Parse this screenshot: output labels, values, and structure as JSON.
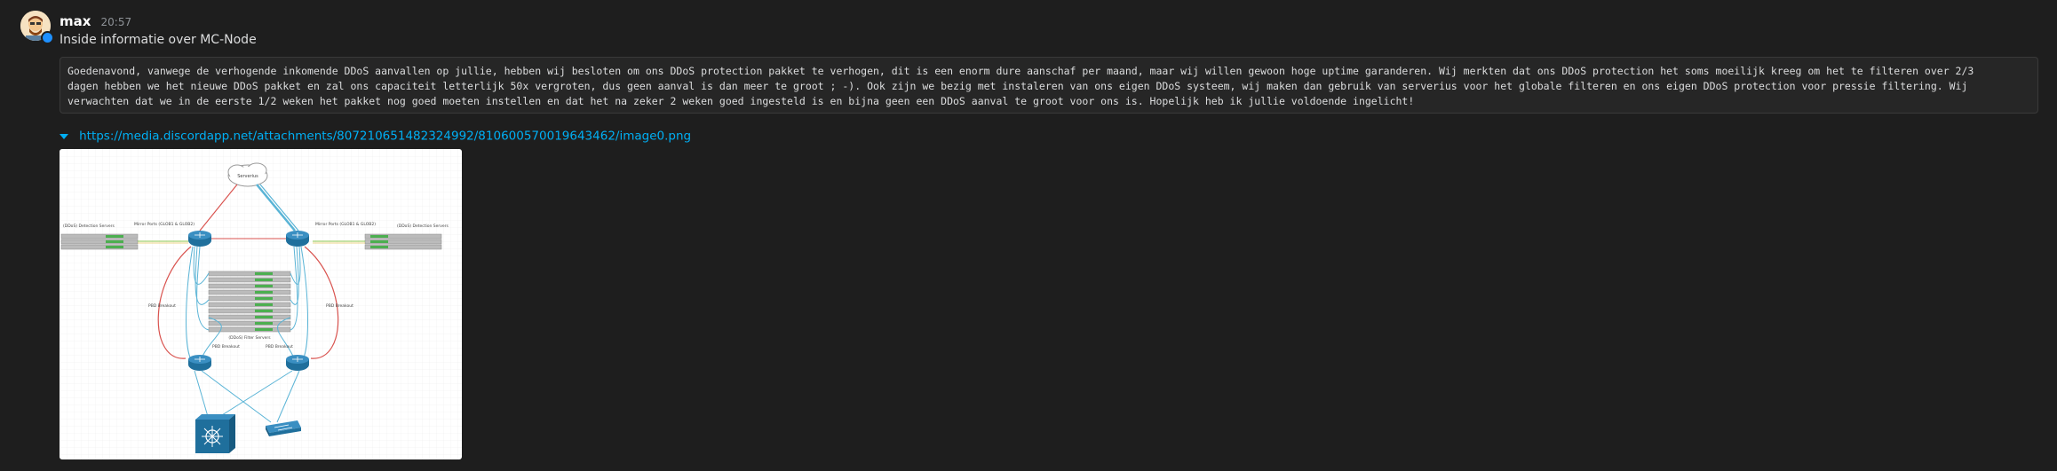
{
  "message": {
    "author": "max",
    "timestamp": "20:57",
    "title": "Inside informatie over MC-Node",
    "body_lines": [
      "Goedenavond, vanwege de verhogende inkomende DDoS aanvallen op jullie, hebben wij besloten om ons DDoS protection pakket te verhogen, dit is een enorm dure aanschaf per maand, maar wij willen gewoon hoge uptime garanderen. Wij merkten dat ons DDoS protection het soms moeilijk kreeg om het te filteren over 2/3",
      "dagen hebben we het nieuwe DDoS pakket en zal ons capaciteit letterlijk 50x vergroten, dus geen aanval is dan meer te groot ; -). Ook zijn we bezig met instaleren van ons eigen DDoS systeem, wij maken dan gebruik van serverius voor het globale filteren en ons eigen DDoS protection voor pressie filtering. Wij",
      "verwachten dat we in de eerste 1/2 weken het pakket nog goed moeten instellen en dat het na zeker 2 weken goed ingesteld is en bijna geen een DDoS aanval te groot voor ons is. Hopelijk heb ik jullie voldoende ingelicht!"
    ],
    "link": "https://media.discordapp.net/attachments/807210651482324992/810600570019643462/image0.png"
  },
  "diagram": {
    "cloud_label": "Serverius",
    "left_server_label": "(DDoS) Detection Servers",
    "right_server_label": "(DDoS) Detection Servers",
    "left_router_label": "Mirror Ports (GLOB1 & GLOB2)",
    "right_router_label": "Mirror Ports (GLOB1 & GLOB2)",
    "filter_label": "(DDoS) Filter Servers",
    "left_breakout": "PBD Breakout",
    "right_breakout": "PBD Breakout",
    "lower_left_breakout": "PBD Breakout",
    "lower_right_breakout": "PBD Breakout"
  },
  "colors": {
    "link": "#00aff4",
    "background": "#1e1e1e",
    "router": "#1f6f9c",
    "red_link": "#d9534f",
    "blue_link": "#5ab4d6"
  }
}
